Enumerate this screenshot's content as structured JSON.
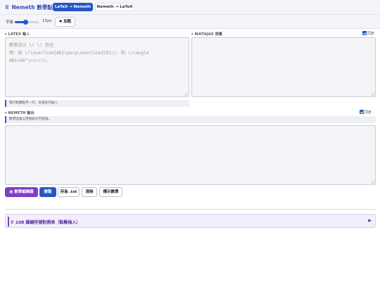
{
  "header": {
    "brand_icon": "⠿",
    "brand": "Nemeth 數學點字",
    "tabs": [
      {
        "label": "LaTeX → Nemeth",
        "active": true
      },
      {
        "label": "Nemeth → LaTeX",
        "active": false
      }
    ]
  },
  "toolbar": {
    "font_label": "字級",
    "font_size": "15px",
    "slider_fraction": 0.45,
    "bold_label": "✱ 加粗"
  },
  "latex_panel": {
    "label": "▾ LATEX 輸入",
    "placeholder": "數學式以 \\( \\) 包住\n例：設 \\(\\overline{AB}\\perp\\overline{CD}\\)，則 \\(\\angle ABC=90^\\circ\\)。",
    "hint": "每行對應點字一行，支援多行輸入"
  },
  "mathjax_panel": {
    "label": "▾ MATHJAX 預覽",
    "sync_label": "同步",
    "sync_checked": true
  },
  "nemeth_panel": {
    "label": "▾ NEMETH 輸出",
    "sync_label": "同步",
    "sync_checked": true,
    "hint": "數學區塊以空格與文字區隔。"
  },
  "actions": {
    "editor_label": "▦ 數學編輯器",
    "copy_label": "複製",
    "save_label": "存為 .txt",
    "clear_label": "清除",
    "mark_label": "標示數學"
  },
  "collapsible": {
    "title": "⠿ 108 課綱符號對照表（點擊插入）",
    "arrow": "▶"
  },
  "colors": {
    "primary": "#2456c6",
    "accent": "#7b3fc4"
  }
}
